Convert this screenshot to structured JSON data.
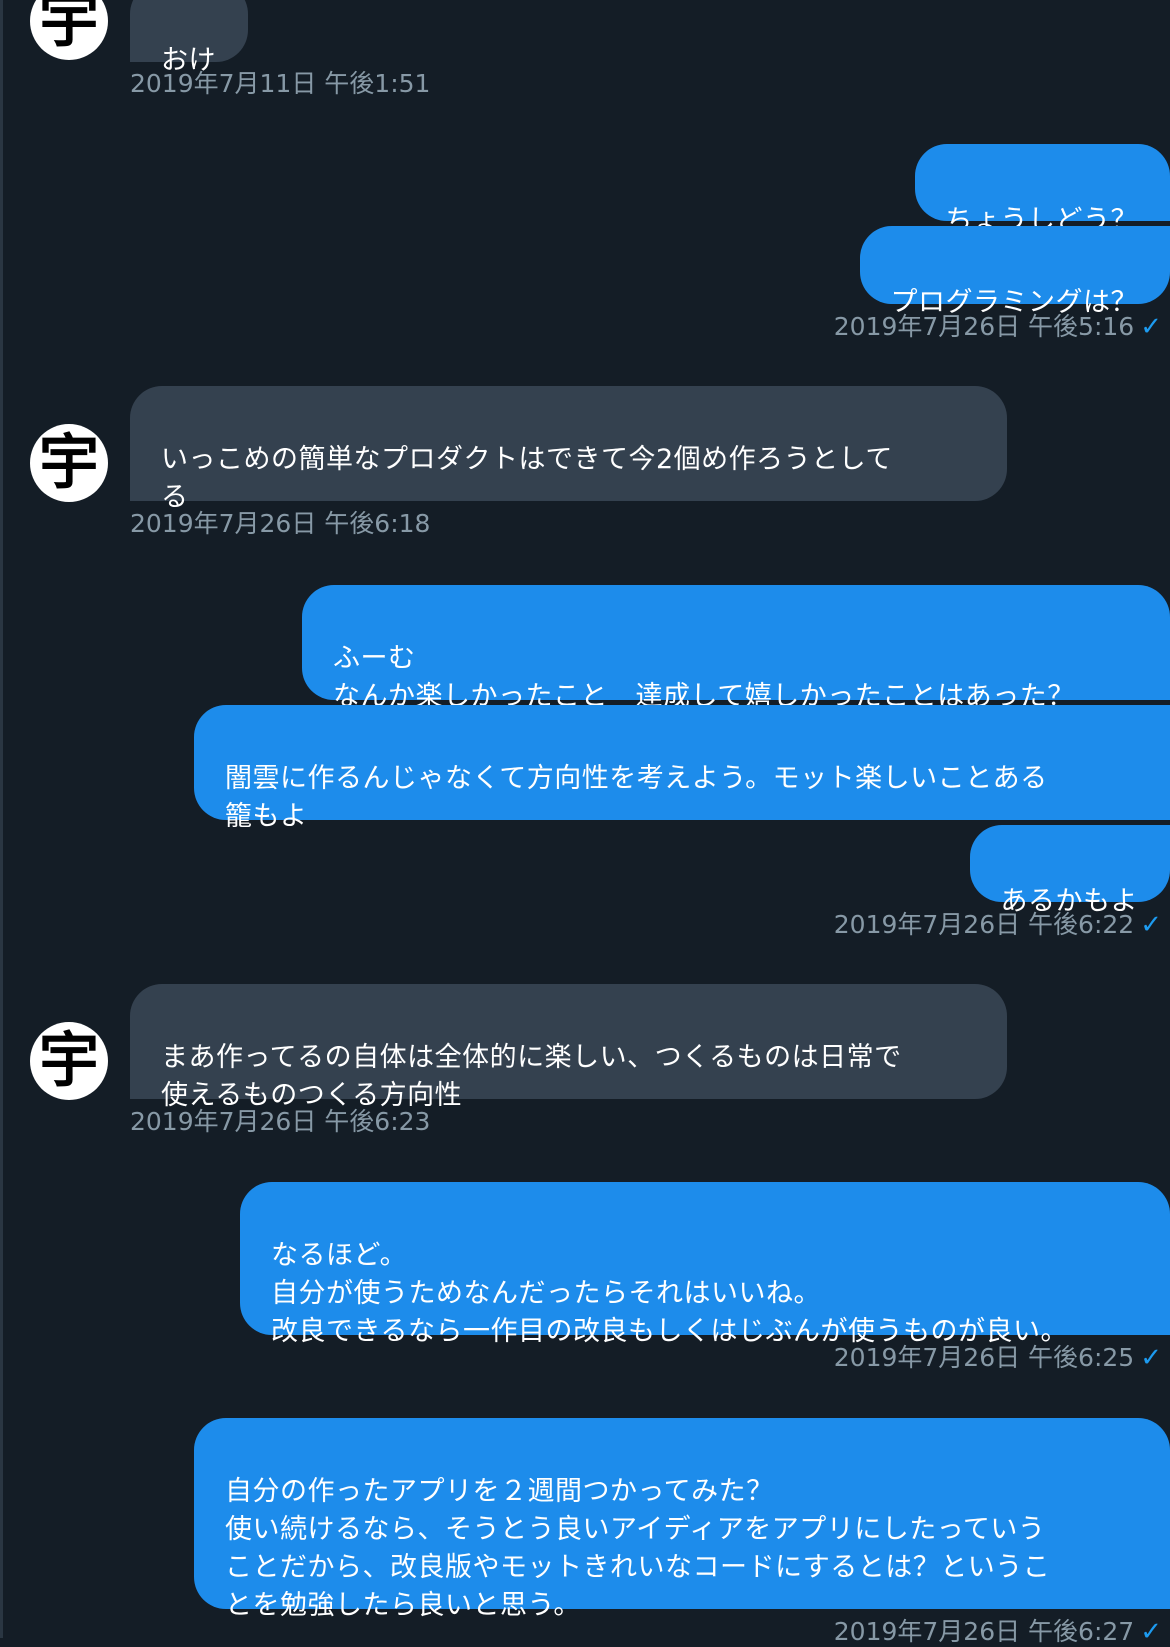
{
  "partner_avatar_glyph": "宇",
  "accent_color": "#1d8ceb",
  "messages": [
    {
      "side": "in",
      "text": "おけ"
    },
    {
      "side": "out",
      "text": "ちょうしどう？"
    },
    {
      "side": "out",
      "text": "プログラミングは？"
    },
    {
      "side": "in",
      "text": "いっこめの簡単なプロダクトはできて今2個め作ろうとして\nる"
    },
    {
      "side": "out",
      "text": "ふーむ\nなんか楽しかったこと　達成して嬉しかったことはあった？"
    },
    {
      "side": "out",
      "text": "闇雲に作るんじゃなくて方向性を考えよう。モット楽しいことある\n籠もよ"
    },
    {
      "side": "out",
      "text": "あるかもよ"
    },
    {
      "side": "in",
      "text": "まあ作ってるの自体は全体的に楽しい、つくるものは日常で\n使えるものつくる方向性"
    },
    {
      "side": "out",
      "text": "なるほど。\n自分が使うためなんだったらそれはいいね。\n改良できるなら一作目の改良もしくはじぶんが使うものが良い。"
    },
    {
      "side": "out",
      "text": "自分の作ったアプリを２週間つかってみた？\n使い続けるなら、そうとう良いアイディアをアプリにしたっていう\nことだから、改良版やモットきれいなコードにするとは？というこ\nとを勉強したら良いと思う。"
    }
  ],
  "timestamps": [
    "2019年7月11日 午後1:51",
    "2019年7月26日 午後5:16",
    "2019年7月26日 午後6:18",
    "2019年7月26日 午後6:22",
    "2019年7月26日 午後6:23",
    "2019年7月26日 午後6:25",
    "2019年7月26日 午後6:27"
  ],
  "read_mark": "✓"
}
